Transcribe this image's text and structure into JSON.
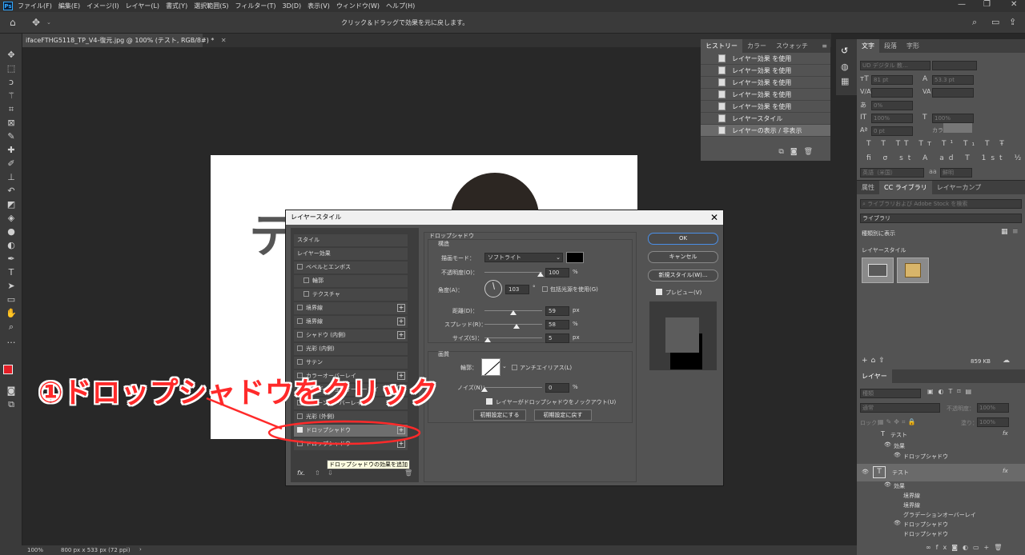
{
  "app": {
    "logo": "Ps"
  },
  "menu": [
    "ファイル(F)",
    "編集(E)",
    "イメージ(I)",
    "レイヤー(L)",
    "書式(Y)",
    "選択範囲(S)",
    "フィルター(T)",
    "3D(D)",
    "表示(V)",
    "ウィンドウ(W)",
    "ヘルプ(H)"
  ],
  "options_bar": {
    "hint": "クリック＆ドラッグで効果を元に戻します。"
  },
  "document": {
    "tab_title": "ifaceFTHG5118_TP_V4-復元.jpg @ 100% (テスト, RGB/8#) *",
    "canvas_text": "テ"
  },
  "status": {
    "zoom": "100%",
    "size": "800 px x 533 px (72 ppi)"
  },
  "history_panel": {
    "tabs": [
      "ヒストリー",
      "カラー",
      "スウォッチ"
    ],
    "items": [
      "レイヤー効果 を使用",
      "レイヤー効果 を使用",
      "レイヤー効果 を使用",
      "レイヤー効果 を使用",
      "レイヤー効果 を使用",
      "レイヤースタイル",
      "レイヤーの表示 / 非表示"
    ]
  },
  "char_panel": {
    "tabs": [
      "文字",
      "段落",
      "字形"
    ],
    "font": "UD デジタル 教…",
    "size1": "81 pt",
    "leading": "53.3 pt",
    "tracking": "0%",
    "scale_v": "100%",
    "scale_h": "100%",
    "baseline": "0 pt",
    "color_label": "カラー：",
    "language": "英語（米国）",
    "aa": "aa",
    "aa_mode": "鮮明"
  },
  "lib_panel": {
    "tabs": [
      "属性",
      "CC ライブラリ",
      "レイヤーカンプ"
    ],
    "search": "ライブラリおよび Adobe Stock を検索",
    "library": "ライブラリ",
    "view": "種類別に表示",
    "section": "レイヤースタイル",
    "size": "859 KB"
  },
  "layers_panel": {
    "tab": "レイヤー",
    "filter": "種類",
    "blend": "通常",
    "opacity_label": "不透明度：",
    "opacity": "100%",
    "lock_label": "ロック：",
    "fill_label": "塗り：",
    "fill": "100%",
    "rows": [
      {
        "name": "テスト",
        "indent": 0,
        "type": "T"
      },
      {
        "name": "効果",
        "indent": 1
      },
      {
        "name": "ドロップシャドウ",
        "indent": 2
      },
      {
        "name": "テスト",
        "indent": 0,
        "type": "T",
        "selected": true
      },
      {
        "name": "効果",
        "indent": 1
      },
      {
        "name": "境界線",
        "indent": 2
      },
      {
        "name": "境界線",
        "indent": 2
      },
      {
        "name": "グラデーションオーバーレイ",
        "indent": 2
      },
      {
        "name": "ドロップシャドウ",
        "indent": 2
      },
      {
        "name": "ドロップシャドウ",
        "indent": 2
      }
    ]
  },
  "dialog": {
    "title": "レイヤースタイル",
    "styles": [
      {
        "label": "スタイル",
        "type": "header"
      },
      {
        "label": "レイヤー効果",
        "type": "header"
      },
      {
        "label": "ベベルとエンボス",
        "cb": true
      },
      {
        "label": "輪郭",
        "cb": true,
        "sub": true
      },
      {
        "label": "テクスチャ",
        "cb": true,
        "sub": true
      },
      {
        "label": "境界線",
        "cb": true,
        "plus": true
      },
      {
        "label": "境界線",
        "cb": true,
        "plus": true
      },
      {
        "label": "シャドウ (内側)",
        "cb": true,
        "plus": true
      },
      {
        "label": "光彩 (内側)",
        "cb": true
      },
      {
        "label": "サテン",
        "cb": true
      },
      {
        "label": "カラーオーバーレイ",
        "cb": true,
        "plus": true
      },
      {
        "label": "グラデーションオーバーレイ",
        "cb": true,
        "plus": true
      },
      {
        "label": "パターンオーバーレイ",
        "cb": true
      },
      {
        "label": "光彩 (外側)",
        "cb": true
      },
      {
        "label": "ドロップシャドウ",
        "cb": true,
        "checked": true,
        "selected": true,
        "plus": true
      },
      {
        "label": "ドロップシャドウ",
        "cb": true,
        "plus": true
      }
    ],
    "tooltip": "ドロップシャドウの効果を追加",
    "section_title": "ドロップシャドウ",
    "structure_title": "構造",
    "blend_label": "描画モード：",
    "blend_value": "ソフトライト",
    "opacity_label": "不透明度(O)：",
    "opacity": "100",
    "pct": "%",
    "angle_label": "角度(A)：",
    "angle": "103",
    "deg": "°",
    "global_light": "包括光源を使用(G)",
    "distance_label": "距離(D)：",
    "distance": "59",
    "px": "px",
    "spread_label": "スプレッド(R)：",
    "spread": "58",
    "size_label": "サイズ(S)：",
    "size": "5",
    "quality_title": "画質",
    "contour_label": "輪郭：",
    "antialias": "アンチエイリアス(L)",
    "noise_label": "ノイズ(N)：",
    "noise": "0",
    "knockout": "レイヤーがドロップシャドウをノックアウト(U)",
    "btn_default": "初期設定にする",
    "btn_reset": "初期設定に戻す",
    "ok": "OK",
    "cancel": "キャンセル",
    "new_style": "新規スタイル(W)...",
    "preview": "プレビュー(V)",
    "fx": "fx."
  },
  "annotation": "①ドロップシャドウをクリック",
  "colors": {
    "accent_red": "#ff2a2a",
    "fg_swatch": "#e41e26"
  }
}
